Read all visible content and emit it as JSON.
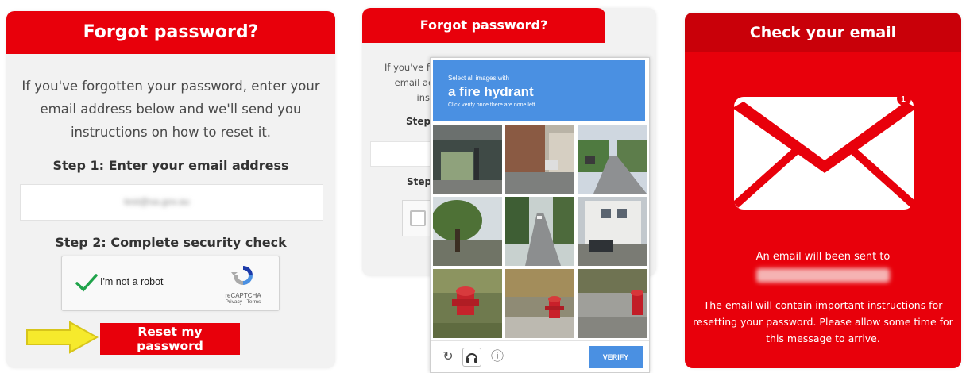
{
  "panel1": {
    "title": "Forgot password?",
    "intro": "If you've forgotten your password, enter your email address below and we'll send you instructions on how to reset it.",
    "step1": "Step 1: Enter your email address",
    "email_value": "test@sa.gov.au",
    "step2": "Step 2: Complete security check",
    "recaptcha_label": "I'm not a robot",
    "recaptcha_brand": "reCAPTCHA",
    "recaptcha_terms": "Privacy - Terms",
    "reset_label": "Reset my password"
  },
  "panel2": {
    "title": "Forgot password?",
    "intro_lines": [
      "If you've fo",
      "email ac",
      "inst"
    ],
    "step_partial_1": "Step",
    "step_partial_2": "Step",
    "challenge": {
      "line1": "Select all images with",
      "line2": "a fire hydrant",
      "line3": "Click verify once there are none left.",
      "verify_label": "VERIFY",
      "footer_icons": [
        "reload-icon",
        "headphones-icon",
        "info-icon"
      ]
    }
  },
  "panel3": {
    "title": "Check your email",
    "badge": "1",
    "sent_label": "An email will been sent to",
    "body": "The email will contain important instructions for resetting your password. Please allow some time for this message to arrive."
  },
  "colors": {
    "brand_red": "#e8000b",
    "dark_red": "#c90009",
    "captcha_blue": "#4a90e2",
    "arrow_yellow": "#f6ea2c",
    "check_green": "#1fa34a"
  }
}
